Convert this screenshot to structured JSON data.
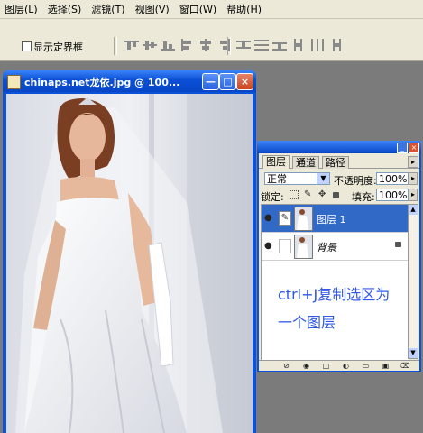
{
  "menu": {
    "items": [
      "图层(L)",
      "选择(S)",
      "滤镜(T)",
      "视图(V)",
      "窗口(W)",
      "帮助(H)"
    ]
  },
  "options": {
    "show_bounds_label": "显示定界框"
  },
  "document": {
    "title": "chinaps.net龙依.jpg @ 100...",
    "minimize_glyph": "—",
    "maximize_glyph": "□",
    "close_glyph": "×"
  },
  "panel": {
    "tabs": [
      "图层",
      "通道",
      "路径"
    ],
    "blend_mode": "正常",
    "opacity_label": "不透明度:",
    "opacity_value": "100%",
    "lock_label": "锁定:",
    "fill_label": "填充:",
    "fill_value": "100%",
    "layers": [
      {
        "name": "图层 1",
        "selected": true
      },
      {
        "name": "背景",
        "selected": false
      }
    ],
    "annotation_line1": "ctrl+J复制选区为",
    "annotation_line2": "一个图层"
  },
  "colors": {
    "titlebar_blue": "#0a52d8",
    "selected_layer": "#3169c6",
    "annotation_text": "#2f58e5",
    "close_red": "#d6542f"
  }
}
